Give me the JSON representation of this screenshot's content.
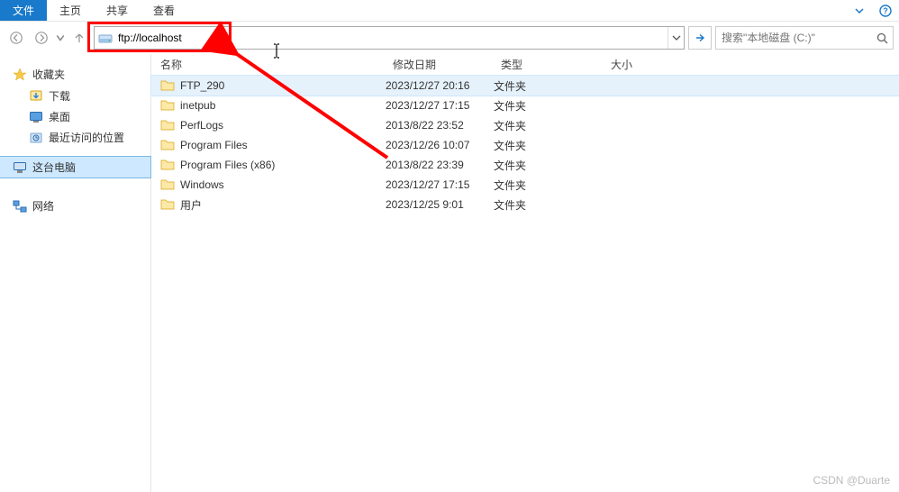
{
  "menu": {
    "file": "文件",
    "home": "主页",
    "share": "共享",
    "view": "查看"
  },
  "address": {
    "value": "ftp://localhost"
  },
  "search": {
    "placeholder": "搜索\"本地磁盘 (C:)\""
  },
  "sidebar": {
    "favorites": {
      "label": "收藏夹",
      "items": [
        {
          "label": "下载",
          "icon": "download"
        },
        {
          "label": "桌面",
          "icon": "desktop"
        },
        {
          "label": "最近访问的位置",
          "icon": "recent"
        }
      ]
    },
    "thispc": {
      "label": "这台电脑"
    },
    "network": {
      "label": "网络"
    }
  },
  "columns": {
    "name": "名称",
    "date": "修改日期",
    "type": "类型",
    "size": "大小"
  },
  "files": [
    {
      "name": "FTP_290",
      "date": "2023/12/27 20:16",
      "type": "文件夹",
      "selected": true
    },
    {
      "name": "inetpub",
      "date": "2023/12/27 17:15",
      "type": "文件夹"
    },
    {
      "name": "PerfLogs",
      "date": "2013/8/22 23:52",
      "type": "文件夹"
    },
    {
      "name": "Program Files",
      "date": "2023/12/26 10:07",
      "type": "文件夹"
    },
    {
      "name": "Program Files (x86)",
      "date": "2013/8/22 23:39",
      "type": "文件夹"
    },
    {
      "name": "Windows",
      "date": "2023/12/27 17:15",
      "type": "文件夹"
    },
    {
      "name": "用户",
      "date": "2023/12/25 9:01",
      "type": "文件夹"
    }
  ],
  "watermark": "CSDN @Duarte"
}
